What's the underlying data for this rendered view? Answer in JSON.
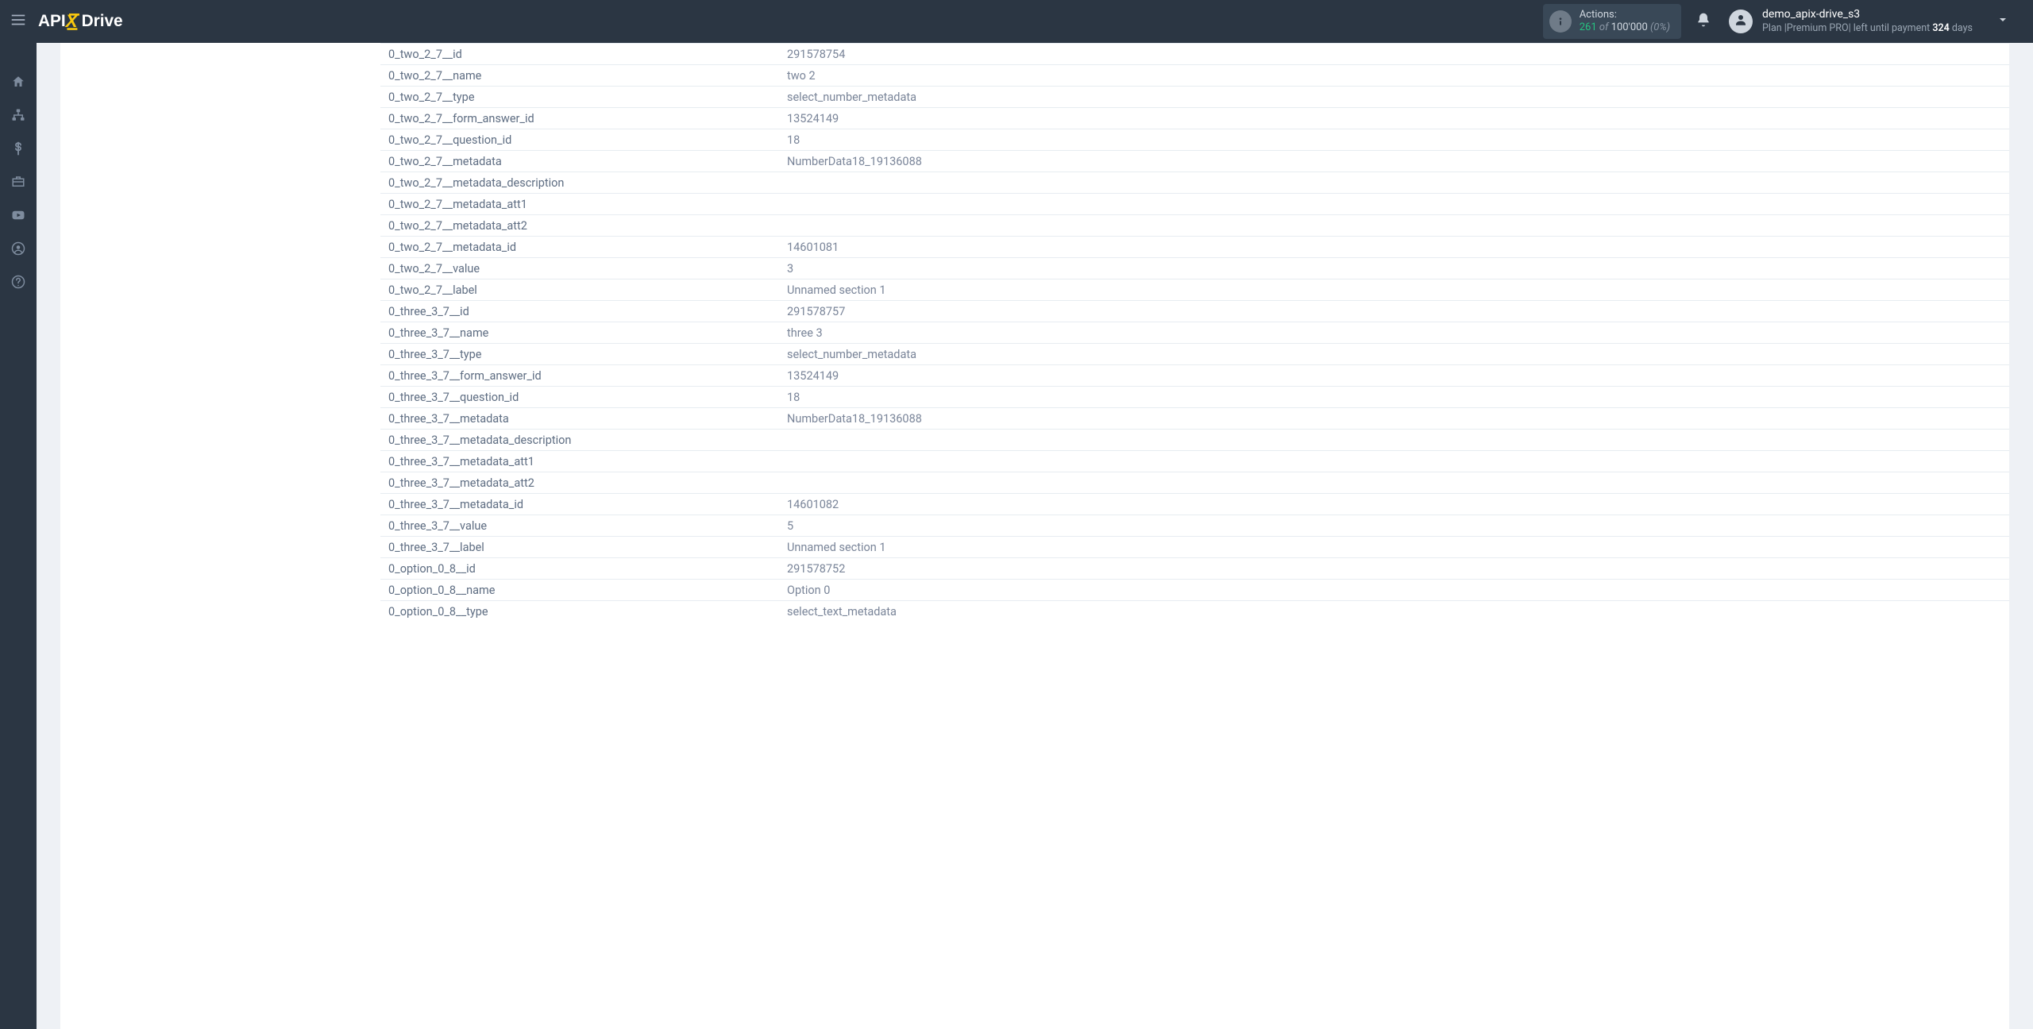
{
  "header": {
    "actions": {
      "label": "Actions:",
      "count": "261",
      "of": "of",
      "total": "100'000",
      "pct": "(0%)"
    },
    "user": {
      "username": "demo_apix-drive_s3",
      "plan_prefix": "Plan |",
      "plan_name": "Premium PRO",
      "plan_mid": "| left until payment ",
      "days": "324",
      "days_suffix": " days"
    }
  },
  "rows": [
    {
      "key": "0_two_2_7__id",
      "val": "291578754"
    },
    {
      "key": "0_two_2_7__name",
      "val": "two 2"
    },
    {
      "key": "0_two_2_7__type",
      "val": "select_number_metadata"
    },
    {
      "key": "0_two_2_7__form_answer_id",
      "val": "13524149"
    },
    {
      "key": "0_two_2_7__question_id",
      "val": "18"
    },
    {
      "key": "0_two_2_7__metadata",
      "val": "NumberData18_19136088"
    },
    {
      "key": "0_two_2_7__metadata_description",
      "val": ""
    },
    {
      "key": "0_two_2_7__metadata_att1",
      "val": ""
    },
    {
      "key": "0_two_2_7__metadata_att2",
      "val": ""
    },
    {
      "key": "0_two_2_7__metadata_id",
      "val": "14601081"
    },
    {
      "key": "0_two_2_7__value",
      "val": "3"
    },
    {
      "key": "0_two_2_7__label",
      "val": "Unnamed section 1"
    },
    {
      "key": "0_three_3_7__id",
      "val": "291578757"
    },
    {
      "key": "0_three_3_7__name",
      "val": "three 3"
    },
    {
      "key": "0_three_3_7__type",
      "val": "select_number_metadata"
    },
    {
      "key": "0_three_3_7__form_answer_id",
      "val": "13524149"
    },
    {
      "key": "0_three_3_7__question_id",
      "val": "18"
    },
    {
      "key": "0_three_3_7__metadata",
      "val": "NumberData18_19136088"
    },
    {
      "key": "0_three_3_7__metadata_description",
      "val": ""
    },
    {
      "key": "0_three_3_7__metadata_att1",
      "val": ""
    },
    {
      "key": "0_three_3_7__metadata_att2",
      "val": ""
    },
    {
      "key": "0_three_3_7__metadata_id",
      "val": "14601082"
    },
    {
      "key": "0_three_3_7__value",
      "val": "5"
    },
    {
      "key": "0_three_3_7__label",
      "val": "Unnamed section 1"
    },
    {
      "key": "0_option_0_8__id",
      "val": "291578752"
    },
    {
      "key": "0_option_0_8__name",
      "val": "Option 0"
    },
    {
      "key": "0_option_0_8__type",
      "val": "select_text_metadata"
    }
  ]
}
